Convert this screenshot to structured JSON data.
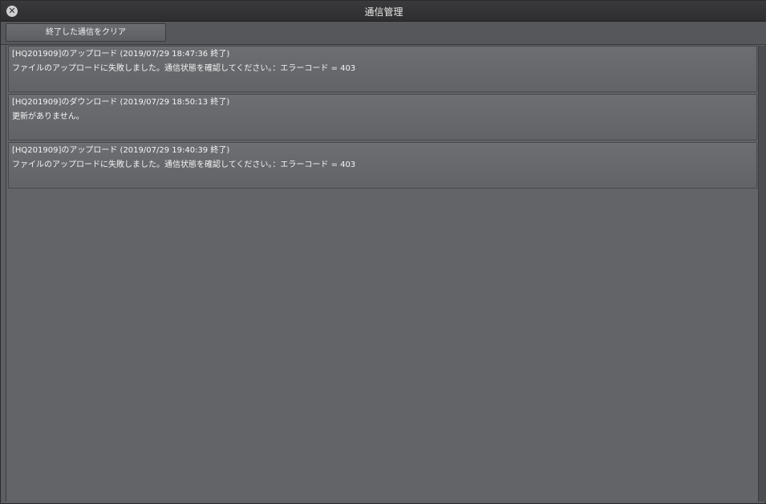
{
  "window": {
    "title": "通信管理"
  },
  "toolbar": {
    "clear_label": "終了した通信をクリア"
  },
  "items": [
    {
      "head": "[HQ201909]のアップロード (2019/07/29 18:47:36 終了)",
      "message": "ファイルのアップロードに失敗しました。通信状態を確認してください。：エラーコード = 403"
    },
    {
      "head": "[HQ201909]のダウンロード (2019/07/29 18:50:13 終了)",
      "message": "更新がありません。"
    },
    {
      "head": "[HQ201909]のアップロード (2019/07/29 19:40:39 終了)",
      "message": "ファイルのアップロードに失敗しました。通信状態を確認してください。：エラーコード = 403"
    }
  ]
}
